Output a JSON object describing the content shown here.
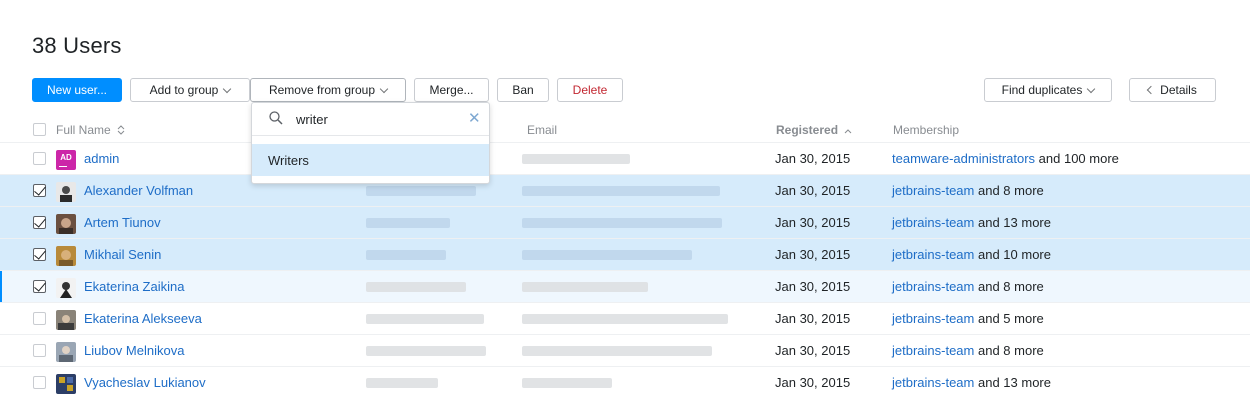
{
  "page": {
    "title": "38 Users"
  },
  "toolbar": {
    "new_user": "New user...",
    "add_to_group": "Add to group",
    "remove_from_group": "Remove from group",
    "merge": "Merge...",
    "ban": "Ban",
    "delete": "Delete",
    "find_duplicates": "Find duplicates",
    "details": "Details"
  },
  "dropdown": {
    "search_value": "writer",
    "items": [
      "Writers"
    ]
  },
  "columns": {
    "full_name": "Full Name",
    "email": "Email",
    "registered": "Registered",
    "membership": "Membership"
  },
  "users": [
    {
      "name": "admin",
      "avatar": "AD",
      "registered": "Jan 30, 2015",
      "membership_group": "teamware-administrators",
      "membership_more": "and 100 more",
      "checked": false
    },
    {
      "name": "Alexander Volfman",
      "registered": "Jan 30, 2015",
      "membership_group": "jetbrains-team",
      "membership_more": "and 8 more",
      "checked": true
    },
    {
      "name": "Artem Tiunov",
      "registered": "Jan 30, 2015",
      "membership_group": "jetbrains-team",
      "membership_more": "and 13 more",
      "checked": true
    },
    {
      "name": "Mikhail Senin",
      "registered": "Jan 30, 2015",
      "membership_group": "jetbrains-team",
      "membership_more": "and 10 more",
      "checked": true
    },
    {
      "name": "Ekaterina Zaikina",
      "registered": "Jan 30, 2015",
      "membership_group": "jetbrains-team",
      "membership_more": "and 8 more",
      "checked": true
    },
    {
      "name": "Ekaterina Alekseeva",
      "registered": "Jan 30, 2015",
      "membership_group": "jetbrains-team",
      "membership_more": "and 5 more",
      "checked": false
    },
    {
      "name": "Liubov Melnikova",
      "registered": "Jan 30, 2015",
      "membership_group": "jetbrains-team",
      "membership_more": "and 8 more",
      "checked": false
    },
    {
      "name": "Vyacheslav Lukianov",
      "registered": "Jan 30, 2015",
      "membership_group": "jetbrains-team",
      "membership_more": "and 13 more",
      "checked": false
    }
  ],
  "colors": {
    "accent": "#008eff",
    "link": "#1e6dc7",
    "selected_row": "#d6ebfb",
    "danger": "#c22731",
    "admin_badge": "#cc26a8"
  }
}
